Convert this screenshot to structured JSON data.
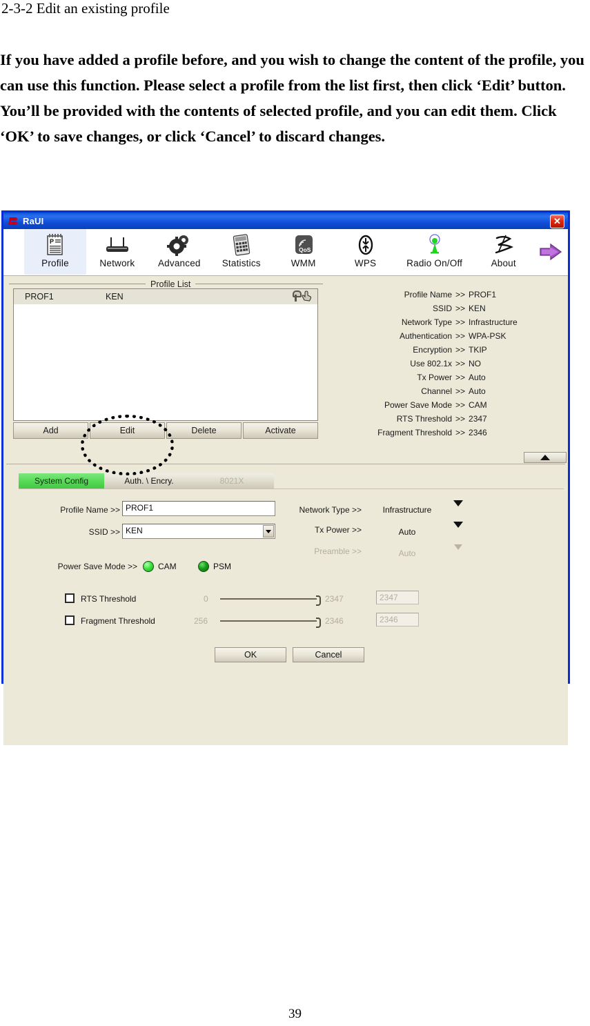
{
  "document": {
    "heading": "2-3-2 Edit an existing profile",
    "paragraph": "If you have added a profile before, and you wish to change the content of the profile, you can use this function. Please select a profile from the list first, then click ‘Edit’ button. You’ll be provided with the contents of selected profile, and you can edit them. Click ‘OK’ to save changes, or click ‘Cancel’ to discard changes.",
    "page_number": "39"
  },
  "window": {
    "title": "RaUI",
    "close_label": "✕",
    "accent_titlebar": "#0f4fd8",
    "border_color": "#0a2ed6",
    "face_color": "#ece9d8"
  },
  "toolbar": {
    "items": [
      {
        "label": "Profile",
        "icon": "profile-icon",
        "active": true
      },
      {
        "label": "Network",
        "icon": "router-icon",
        "active": false
      },
      {
        "label": "Advanced",
        "icon": "gears-icon",
        "active": false
      },
      {
        "label": "Statistics",
        "icon": "calculator-icon",
        "active": false
      },
      {
        "label": "WMM",
        "icon": "qos-icon",
        "active": false
      },
      {
        "label": "WPS",
        "icon": "wps-icon",
        "active": false
      },
      {
        "label": "Radio On/Off",
        "icon": "radio-tower-icon",
        "active": false
      },
      {
        "label": "About",
        "icon": "about-icon",
        "active": false
      }
    ],
    "exit_icon": "exit-arrow-icon"
  },
  "profile_list": {
    "legend": "Profile List",
    "rows": [
      {
        "name": "PROF1",
        "ssid": "KEN",
        "security_icon": "key-icon",
        "status_icon": "hand-pointer-icon"
      }
    ],
    "buttons": [
      {
        "label": "Add"
      },
      {
        "label": "Edit"
      },
      {
        "label": "Delete"
      },
      {
        "label": "Activate"
      }
    ]
  },
  "info_panel": {
    "separator": ">>",
    "rows": [
      {
        "label": "Profile Name",
        "value": "PROF1"
      },
      {
        "label": "SSID",
        "value": "KEN"
      },
      {
        "label": "Network Type",
        "value": "Infrastructure"
      },
      {
        "label": "Authentication",
        "value": "WPA-PSK"
      },
      {
        "label": "Encryption",
        "value": "TKIP"
      },
      {
        "label": "Use 802.1x",
        "value": "NO"
      },
      {
        "label": "Tx Power",
        "value": "Auto"
      },
      {
        "label": "Channel",
        "value": "Auto"
      },
      {
        "label": "Power Save Mode",
        "value": "CAM"
      },
      {
        "label": "RTS Threshold",
        "value": "2347"
      },
      {
        "label": "Fragment Threshold",
        "value": "2346"
      }
    ]
  },
  "collapse_button": {
    "icon": "chevron-up-icon"
  },
  "config": {
    "tabs": [
      {
        "label": "System Config",
        "state": "selected"
      },
      {
        "label": "Auth. \\ Encry.",
        "state": "normal"
      },
      {
        "label": "8021X",
        "state": "disabled"
      }
    ],
    "tab_accent": "#55d955",
    "fields": {
      "profile_name_label": "Profile Name >>",
      "profile_name_value": "PROF1",
      "ssid_label": "SSID >>",
      "ssid_value": "KEN",
      "network_type_label": "Network Type >>",
      "network_type_value": "Infrastructure",
      "tx_power_label": "Tx Power >>",
      "tx_power_value": "Auto",
      "preamble_label": "Preamble >>",
      "preamble_value": "Auto",
      "power_save_label": "Power Save Mode >>",
      "power_save_cam": "CAM",
      "power_save_psm": "PSM",
      "rts_label": "RTS Threshold",
      "rts_min": "0",
      "rts_max": "2347",
      "rts_value": "2347",
      "frag_label": "Fragment Threshold",
      "frag_min": "256",
      "frag_max": "2346",
      "frag_value": "2346"
    },
    "ok_label": "OK",
    "cancel_label": "Cancel"
  }
}
